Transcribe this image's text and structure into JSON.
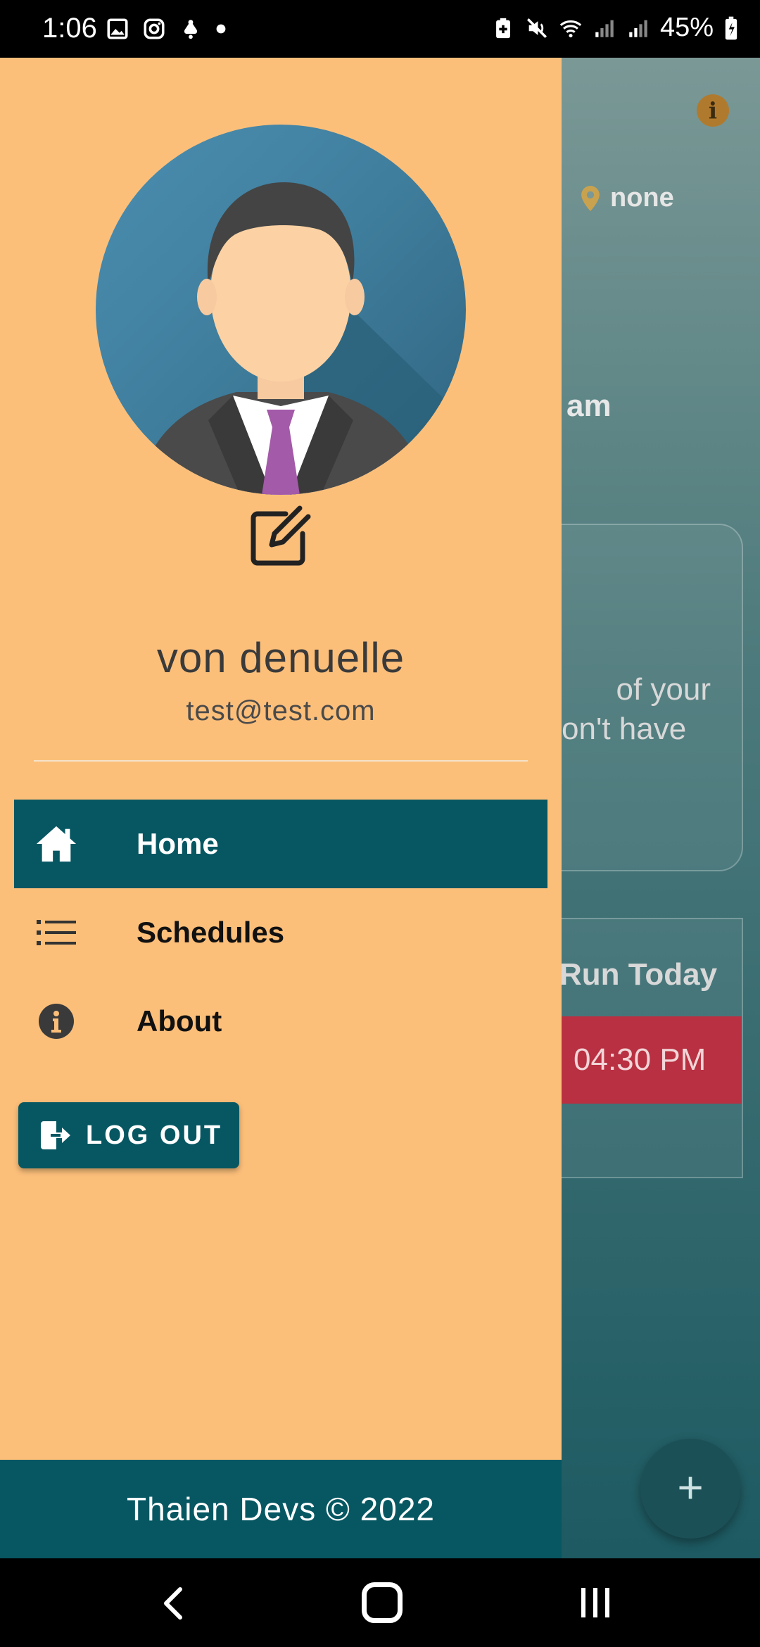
{
  "status_bar": {
    "time": "1:06",
    "battery": "45%",
    "icons_left": [
      "gallery-icon",
      "instagram-icon",
      "notification-icon",
      "dot-icon"
    ],
    "icons_right": [
      "battery-saver-icon",
      "mute-icon",
      "wifi-icon",
      "signal-icon",
      "signal-icon",
      "battery-icon"
    ]
  },
  "background_app": {
    "location_text": "none",
    "greeting_fragment": "am",
    "card_text_line1": "of your",
    "card_text_line2": "on't have",
    "schedule_header": "Run Today",
    "schedule_time": "04:30 PM",
    "fab_label": "+"
  },
  "drawer": {
    "user": {
      "name": "von denuelle",
      "email": "test@test.com"
    },
    "nav_items": [
      {
        "label": "Home",
        "icon": "home-icon",
        "active": true
      },
      {
        "label": "Schedules",
        "icon": "list-icon",
        "active": false
      },
      {
        "label": "About",
        "icon": "info-icon",
        "active": false
      }
    ],
    "logout_label": "LOG OUT",
    "footer": "Thaien Devs © 2022"
  },
  "colors": {
    "drawer_bg": "#fcbf7a",
    "accent": "#065762",
    "schedule_badge": "#b83041"
  }
}
